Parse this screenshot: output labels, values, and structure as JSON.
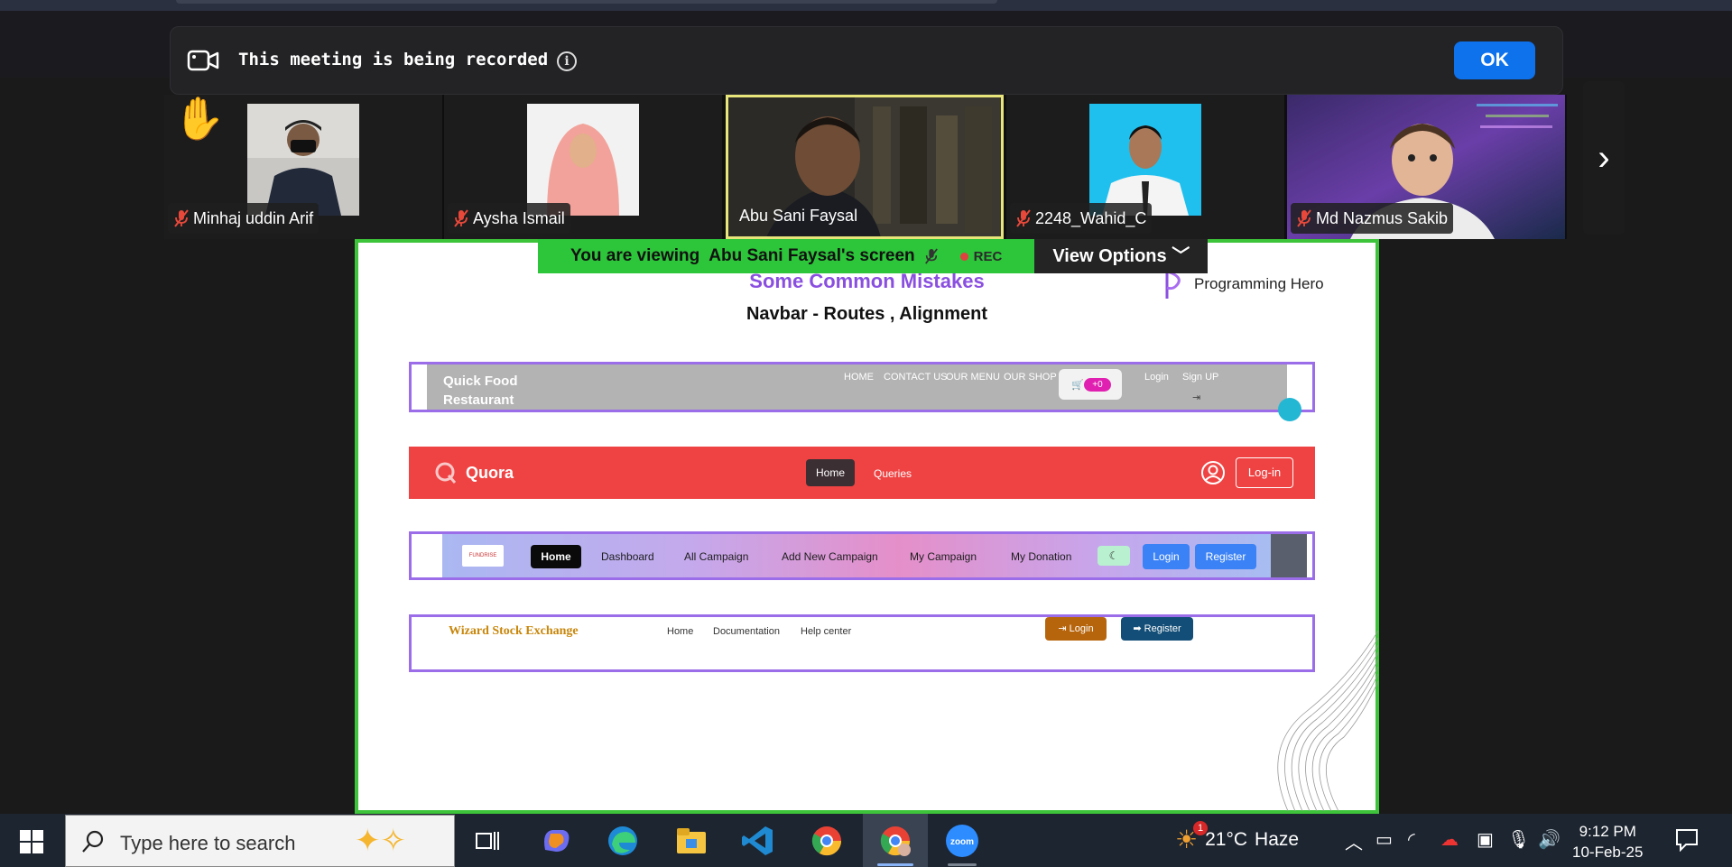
{
  "recording_banner": {
    "text": "This meeting is being recorded",
    "info_icon": "i",
    "ok_label": "OK"
  },
  "participants": [
    {
      "name": "Minhaj uddin Arif",
      "muted": true,
      "raised_hand": true
    },
    {
      "name": "Aysha Ismail",
      "muted": true
    },
    {
      "name": "Abu Sani Faysal",
      "muted": false,
      "active": true
    },
    {
      "name": "2248_Wahid_C",
      "muted": true
    },
    {
      "name": "Md Nazmus Sakib",
      "muted": true
    }
  ],
  "next_arrow": "›",
  "viewing_bar": {
    "prefix": "You are viewing",
    "presenter": "Abu Sani Faysal's screen",
    "rec_label": "REC",
    "view_options": "View Options"
  },
  "slide": {
    "title": "Some Common Mistakes",
    "subtitle": "Navbar - Routes , Alignment",
    "logo_text": "Programming Hero",
    "nav1": {
      "brand": "Quick Food Restaurant",
      "links": [
        "HOME",
        "CONTACT US",
        "OUR MENU",
        "OUR SHOP"
      ],
      "cart_badge": "+0",
      "login": "Login",
      "signup": "Sign UP"
    },
    "nav2": {
      "brand": "Quora",
      "home": "Home",
      "queries": "Queries",
      "login": "Log-in"
    },
    "nav3": {
      "logo_text": "FUNDRISE",
      "home": "Home",
      "links": [
        "Dashboard",
        "All Campaign",
        "Add New Campaign",
        "My Campaign",
        "My Donation"
      ],
      "toggle": "☾",
      "login": "Login",
      "register": "Register"
    },
    "nav4": {
      "brand": "Wizard Stock Exchange",
      "links": [
        "Home",
        "Documentation",
        "Help center"
      ],
      "login": "Login",
      "register": "Register"
    }
  },
  "taskbar": {
    "search_placeholder": "Type here to search",
    "weather_temp": "21°C",
    "weather_desc": "Haze",
    "weather_badge": "1",
    "time": "9:12 PM",
    "date": "10-Feb-25"
  },
  "colors": {
    "ok_button": "#0e72ed",
    "share_border": "#3ec43a",
    "quora_red": "#ef4343",
    "slide_title": "#8a4fe0"
  }
}
